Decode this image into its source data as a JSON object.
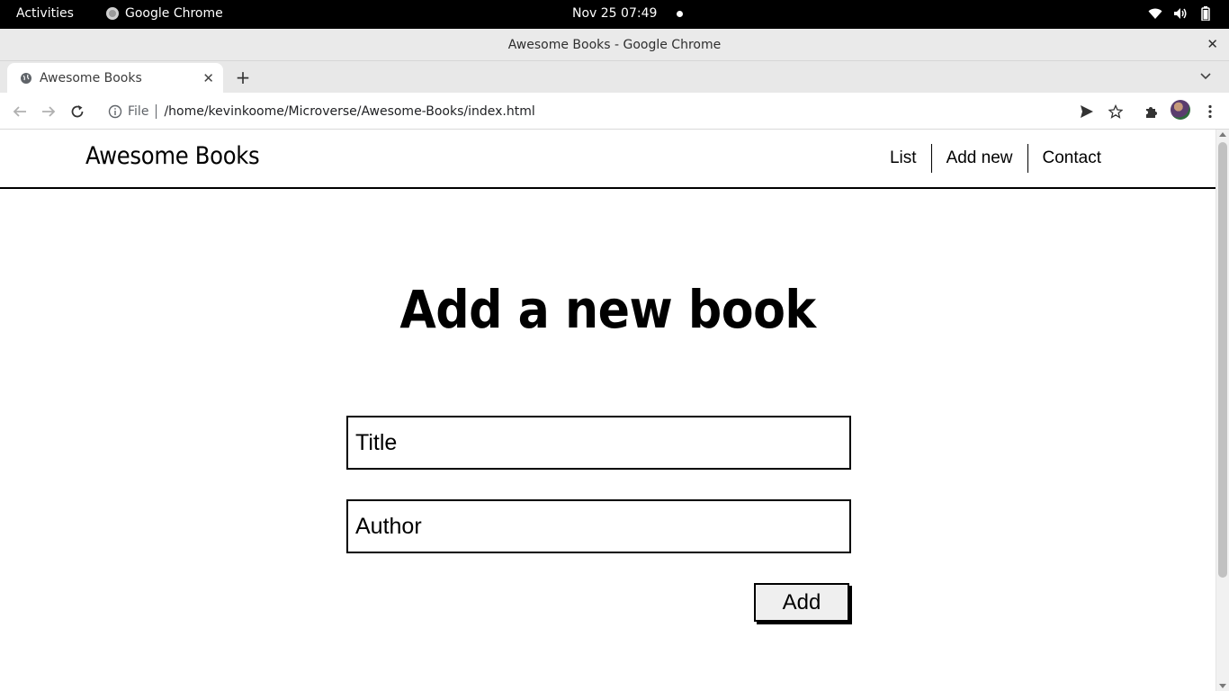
{
  "system_bar": {
    "activities": "Activities",
    "app_name": "Google Chrome",
    "clock": "Nov 25  07:49"
  },
  "window": {
    "title": "Awesome Books - Google Chrome"
  },
  "tabs": [
    {
      "label": "Awesome Books"
    }
  ],
  "omnibox": {
    "scheme": "File",
    "url": "/home/kevinkoome/Microverse/Awesome-Books/index.html"
  },
  "page": {
    "brand": "Awesome Books",
    "nav": [
      {
        "label": "List"
      },
      {
        "label": "Add new"
      },
      {
        "label": "Contact"
      }
    ],
    "heading": "Add a new book",
    "form": {
      "title_placeholder": "Title",
      "author_placeholder": "Author",
      "submit_label": "Add"
    }
  }
}
